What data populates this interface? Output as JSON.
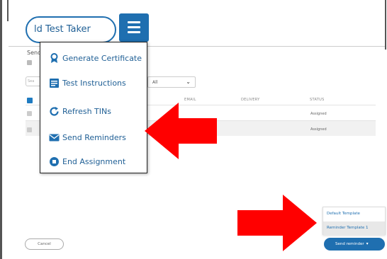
{
  "header": {
    "pill_text": "ld Test Taker"
  },
  "menu": {
    "items": [
      {
        "label": "Generate Certificate",
        "icon": "certificate-icon"
      },
      {
        "label": "Test Instructions",
        "icon": "document-icon"
      },
      {
        "label": "Refresh TINs",
        "icon": "refresh-icon"
      },
      {
        "label": "Send Reminders",
        "icon": "envelope-icon"
      },
      {
        "label": "End Assignment",
        "icon": "stop-circle-icon"
      }
    ]
  },
  "modal": {
    "title": "Send",
    "filter_value": "All",
    "search_placeholder": "Sea",
    "columns": [
      "EMAIL",
      "DELIVERY",
      "STATUS"
    ],
    "rows": [
      {
        "status": "Assigned"
      },
      {
        "status": "Assigned"
      }
    ],
    "cancel_label": "Cancel",
    "send_reminder_label": "Send reminder",
    "templates": [
      "Default Template",
      "Reminder Template 1"
    ]
  },
  "colors": {
    "brand_blue": "#1f6fb0",
    "arrow_red": "#ff0000"
  }
}
